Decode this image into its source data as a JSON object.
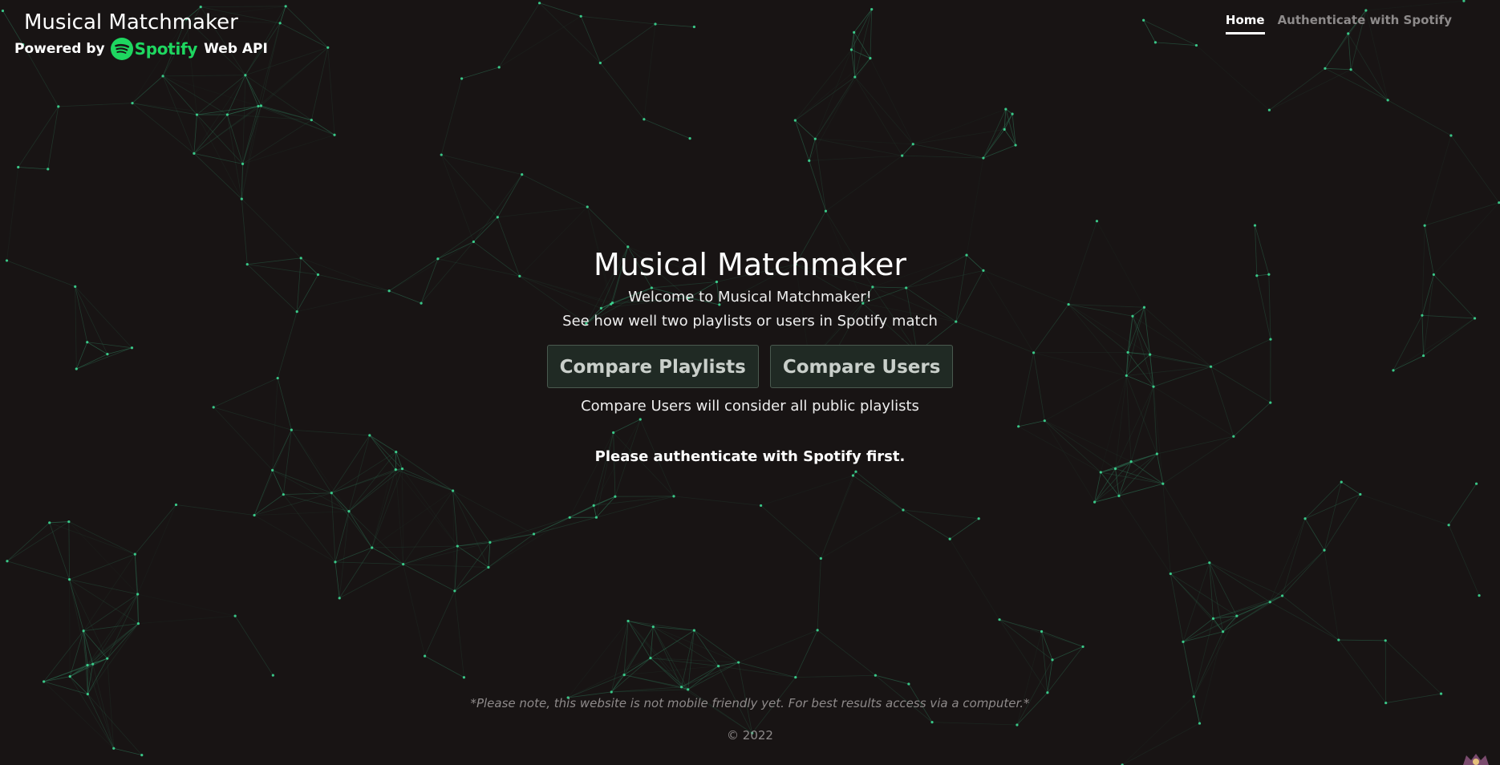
{
  "header": {
    "title": "Musical Matchmaker",
    "powered_prefix": "Powered by",
    "spotify_wordmark": "Spotify",
    "powered_suffix": "Web API"
  },
  "nav": {
    "home": "Home",
    "authenticate": "Authenticate with Spotify"
  },
  "main": {
    "title": "Musical Matchmaker",
    "welcome": "Welcome to Musical Matchmaker!",
    "subtitle": "See how well two playlists or users in Spotify match",
    "compare_playlists": "Compare Playlists",
    "compare_users": "Compare Users",
    "users_note": "Compare Users will consider all public playlists",
    "auth_message": "Please authenticate with Spotify first."
  },
  "footer": {
    "note": "*Please note, this website is not mobile friendly yet. For best results access via a computer.*",
    "copyright": "© 2022"
  },
  "colors": {
    "background": "#181414",
    "spotify_green": "#1ed760",
    "network_line": "#2b6b4f",
    "network_node": "#3fe39a"
  },
  "icons": {
    "spotify_logo": "spotify-icon",
    "corner": "avatar-icon"
  }
}
